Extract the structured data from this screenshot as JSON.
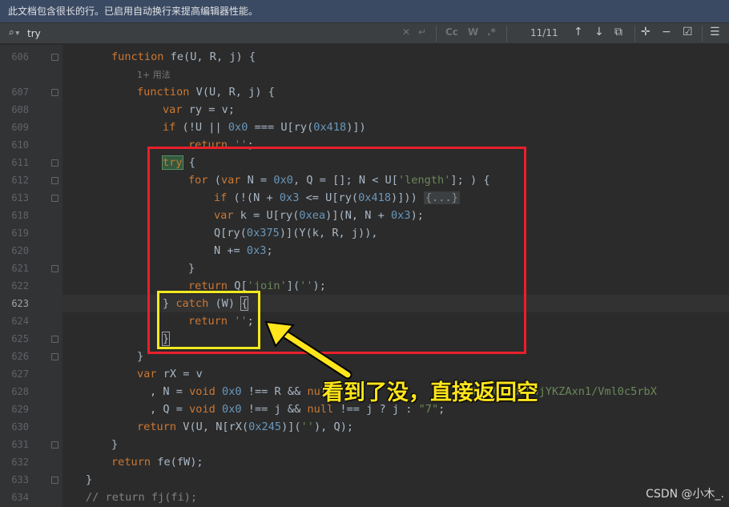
{
  "notice_bar": {
    "text": "此文档包含很长的行。已启用自动换行来提高编辑器性能。"
  },
  "find_bar": {
    "query": "try",
    "match_count": "11/11",
    "icons": [
      "search-icon",
      "clear-icon",
      "replace-history-icon",
      "match-case-icon",
      "words-icon",
      "regex-icon",
      "prev-match-icon",
      "next-match-icon",
      "open-in-window-icon",
      "add-occurrence-icon",
      "remove-occurrence-icon",
      "select-all-icon",
      "filter-icon"
    ],
    "labels": {
      "match_case": "Cc",
      "words": "W",
      "regex": ".*"
    }
  },
  "gutter": {
    "lines": [
      "606",
      "",
      "607",
      "608",
      "609",
      "610",
      "611",
      "612",
      "613",
      "618",
      "619",
      "620",
      "621",
      "622",
      "623",
      "624",
      "625",
      "626",
      "627",
      "628",
      "629",
      "630",
      "631",
      "632",
      "633",
      "634"
    ],
    "current_line": "623"
  },
  "code": {
    "l0": {
      "kw": "function",
      "rest": " fe(U, R, j) {"
    },
    "l1": {
      "hint": "1+ 用法"
    },
    "l2": {
      "kw": "function",
      "rest": " V(U, R, j) {"
    },
    "l3": {
      "kw": "var",
      "rest": " ry = v;"
    },
    "l4": {
      "kw": "if",
      "a": " (!U || ",
      "n": "0x0",
      "b": " === U[ry(",
      "n2": "0x418",
      "c": ")])"
    },
    "l5": {
      "kw": "return",
      "s": "''",
      "tail": ";"
    },
    "l6": {
      "kw": "try",
      "rest": " {"
    },
    "l7": {
      "kw": "for",
      "a": " (",
      "kw2": "var",
      "b": " N = ",
      "n": "0x0",
      "c": ", Q = []; N < U[",
      "s": "'length'",
      "d": "]; ) {"
    },
    "l8": {
      "kw": "if",
      "a": " (!(N + ",
      "n": "0x3",
      "b": " <= U[ry(",
      "n2": "0x418",
      "c": ")])) ",
      "fold": "{...}"
    },
    "l9": {
      "kw": "var",
      "a": " k = U[ry(",
      "n": "0xea",
      "b": ")](N, N + ",
      "n2": "0x3",
      "c": ");"
    },
    "l10": {
      "a": "Q[ry(",
      "n": "0x375",
      "b": ")](Y(k, R, j)),"
    },
    "l11": {
      "a": "N += ",
      "n": "0x3",
      "b": ";"
    },
    "l12": {
      "a": "}"
    },
    "l13": {
      "kw": "return",
      "a": " Q[",
      "s": "'join'",
      "b": "](",
      "s2": "''",
      "c": ");"
    },
    "l14": {
      "a": "} ",
      "kw": "catch",
      "b": " (W) ",
      "brace": "{"
    },
    "l15": {
      "kw": "return",
      "s": " ''",
      "b": ";"
    },
    "l16": {
      "a": "}"
    },
    "l17": {
      "a": "}"
    },
    "l18": {
      "kw": "var",
      "a": " rX = v"
    },
    "l19": {
      "a": ", N = ",
      "kw": "void",
      "n": " 0x0",
      "b": " !== R && ",
      "kw2": "null",
      "s": "'CfHUJ6Tkd9L6jYKZAxn1/Vml0c5rbX"
    },
    "l20": {
      "a": ", Q = ",
      "kw": "void",
      "n": " 0x0",
      "b": " !== j && ",
      "kw2": "null",
      "c": " !== j ? j : ",
      "s": "\"7\"",
      "d": ";"
    },
    "l21": {
      "kw": "return",
      "a": " V(U, N[rX(",
      "n": "0x245",
      "b": ")](",
      "s": "''",
      "c": "), Q);"
    },
    "l22": {
      "a": "}"
    },
    "l23": {
      "kw": "return",
      "a": " fe(fW);"
    },
    "l24": {
      "a": "}"
    },
    "l25": {
      "cmt": "// return fj(fi);"
    }
  },
  "annotation": {
    "text": "看到了没，直接返回空"
  },
  "watermark": {
    "text": "CSDN @小木_."
  },
  "colors": {
    "highlight_red": "#e8202a",
    "highlight_yellow": "#f2ea1d",
    "annotation_text": "#ffe51b"
  }
}
